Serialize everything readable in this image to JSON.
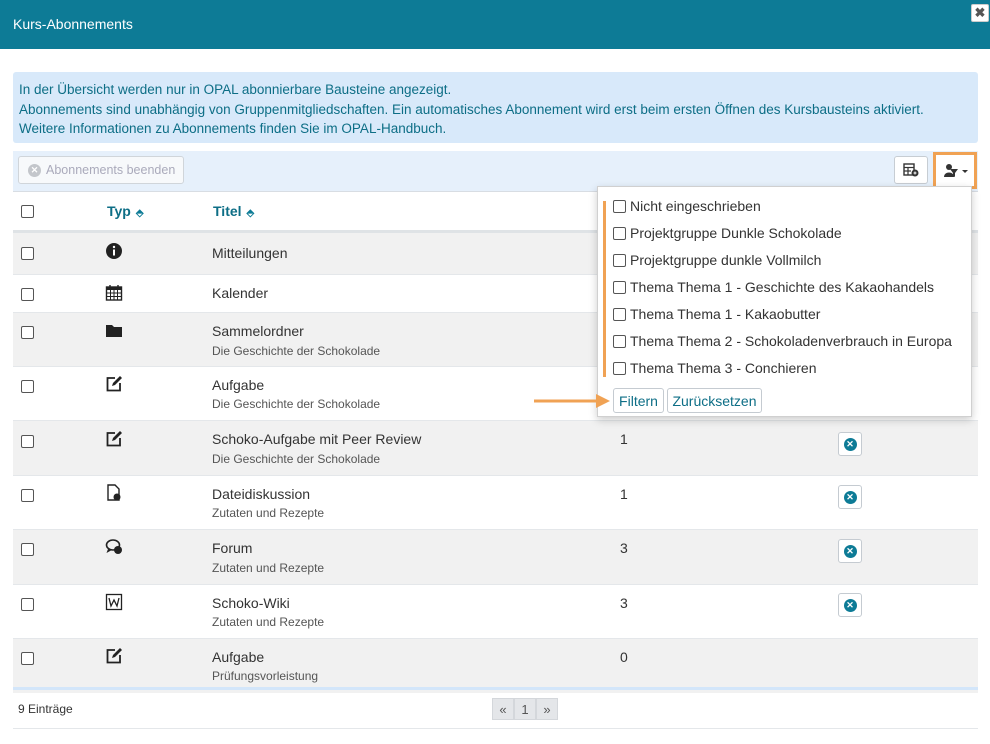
{
  "dialog": {
    "title": "Kurs-Abonnements"
  },
  "info": {
    "line1": "In der Übersicht werden nur in OPAL abonnierbare Bausteine angezeigt.",
    "line2": "Abonnements sind unabhängig von Gruppenmitgliedschaften. Ein automatisches Abonnement wird erst beim ersten Öffnen des Kursbausteins aktiviert.",
    "line3": "Weitere Informationen zu Abonnements finden Sie im OPAL-Handbuch."
  },
  "toolbar": {
    "end_label": "Abonnements beenden"
  },
  "table": {
    "headers": {
      "typ": "Typ",
      "titel": "Titel"
    },
    "rows": [
      {
        "icon": "info-icon",
        "title": "Mitteilungen",
        "sub": "",
        "num": "",
        "unsub": false
      },
      {
        "icon": "calendar-icon",
        "title": "Kalender",
        "sub": "",
        "num": "",
        "unsub": false
      },
      {
        "icon": "folder-icon",
        "title": "Sammelordner",
        "sub": "Die Geschichte der Schokolade",
        "num": "",
        "unsub": false
      },
      {
        "icon": "edit-icon",
        "title": "Aufgabe",
        "sub": "Die Geschichte der Schokolade",
        "num": "",
        "unsub": false
      },
      {
        "icon": "edit-icon",
        "title": "Schoko-Aufgabe mit Peer Review",
        "sub": "Die Geschichte der Schokolade",
        "num": "1",
        "unsub": true
      },
      {
        "icon": "file-discussion-icon",
        "title": "Dateidiskussion",
        "sub": "Zutaten und Rezepte",
        "num": "1",
        "unsub": true
      },
      {
        "icon": "forum-icon",
        "title": "Forum",
        "sub": "Zutaten und Rezepte",
        "num": "3",
        "unsub": true
      },
      {
        "icon": "wiki-icon",
        "title": "Schoko-Wiki",
        "sub": "Zutaten und Rezepte",
        "num": "3",
        "unsub": true
      },
      {
        "icon": "edit-icon",
        "title": "Aufgabe",
        "sub": "Prüfungsvorleistung",
        "num": "0",
        "unsub": false
      }
    ]
  },
  "footer": {
    "count": "9 Einträge",
    "pager": {
      "prev": "«",
      "page": "1",
      "next": "»"
    }
  },
  "filter_menu": {
    "options": [
      "Nicht eingeschrieben",
      "Projektgruppe Dunkle Schokolade",
      "Projektgruppe dunkle Vollmilch",
      "Thema Thema 1 - Geschichte des Kakaohandels",
      "Thema Thema 1 - Kakaobutter",
      "Thema Thema 2 - Schokoladenverbrauch in Europa",
      "Thema Thema 3 - Conchieren"
    ],
    "filter_label": "Filtern",
    "reset_label": "Zurücksetzen"
  },
  "colors": {
    "header": "#0d7b96",
    "info_bg": "#d8e9fa",
    "highlight": "#f0a254"
  }
}
